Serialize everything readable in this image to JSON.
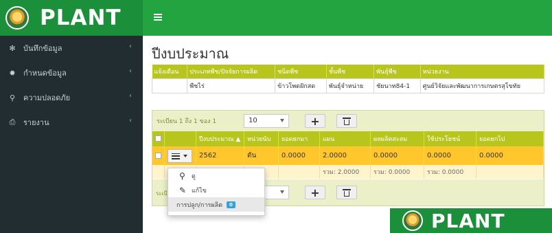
{
  "brand": {
    "name": "PLANT",
    "icon": "plant-logo-icon",
    "color": "#1b8f3a"
  },
  "topbar": {
    "icon": "hamburger-menu-icon",
    "color": "#24a441"
  },
  "sidebar": {
    "items": [
      {
        "label": "บันทึกข้อมูล",
        "icon": "asterisk-icon",
        "glyph": "✻"
      },
      {
        "label": "กำหนดข้อมูล",
        "icon": "cog-icon",
        "glyph": "✹"
      },
      {
        "label": "ความปลอดภัย",
        "icon": "key-icon",
        "glyph": "⚲"
      },
      {
        "label": "รายงาน",
        "icon": "printer-icon",
        "glyph": "⎙"
      }
    ],
    "chevron": "‹"
  },
  "page": {
    "title": "ปีงบประมาณ"
  },
  "info_table": {
    "headers": [
      "แจ้งเตือน",
      "ประเภทพืช/ปัจจัยการผลิต",
      "ชนิดพืช",
      "ชั้นพืช",
      "พันธุ์พืช",
      "หน่วยงาน"
    ],
    "row": [
      "",
      "พืชไร่",
      "ข้าวโพดฝักสด",
      "พันธุ์จำหน่าย",
      "ชัยนาท84-1",
      "ศูนย์วิจัยและพัฒนาการเกษตรสุโขทัย"
    ]
  },
  "budget": {
    "paging_text": "ระเบียน 1 ถึง 1 ของ 1",
    "page_size": "10",
    "add_label": "+",
    "headers": [
      "",
      "",
      "ปีงบประมาณ ▲",
      "หน่วยนับ",
      "ยอดยกมา",
      "แผน",
      "ผลผลิตสะสม",
      "ใช้ประโยชน์",
      "ยอดยกไป"
    ],
    "row": {
      "year": "2562",
      "unit": "ตัน",
      "carried_in": "0.0000",
      "plan": "2.0000",
      "accumulated": "0.0000",
      "used": "0.0000",
      "carried_out": "0.0000"
    },
    "sums": {
      "plan": "รวม: 2.0000",
      "accumulated": "รวม: 0.0000",
      "used": "รวม: 0.0000"
    },
    "footer_paging_text": "ระเบี",
    "footer_page_size": "",
    "header_color": "#b8c51c",
    "row_color": "#ffc72c"
  },
  "action_menu": {
    "items": [
      {
        "label": "ดู",
        "icon": "search-icon",
        "glyph": "⚲"
      },
      {
        "label": "แก้ไข",
        "icon": "pencil-icon",
        "glyph": "✎"
      },
      {
        "label": "การปลูก/การผลิต",
        "badge": "0"
      }
    ]
  },
  "watermark": {
    "name": "PLANT",
    "icon": "plant-logo-icon"
  }
}
